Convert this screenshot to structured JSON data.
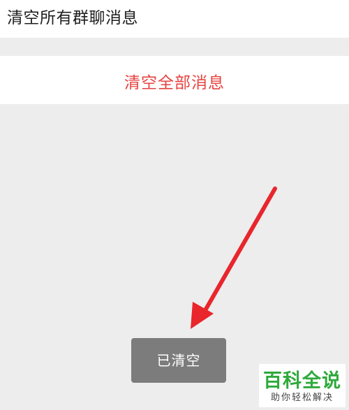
{
  "header": {
    "title": "清空所有群聊消息"
  },
  "actions": {
    "clear_all_label": "清空全部消息"
  },
  "toast": {
    "message": "已清空"
  },
  "watermark": {
    "main": "百科全说",
    "sub": "助你轻松解决"
  },
  "colors": {
    "danger_text": "#e64340",
    "arrow": "#e8262c",
    "toast_bg": "#7c7c7c",
    "watermark_green": "#2ea93a"
  }
}
